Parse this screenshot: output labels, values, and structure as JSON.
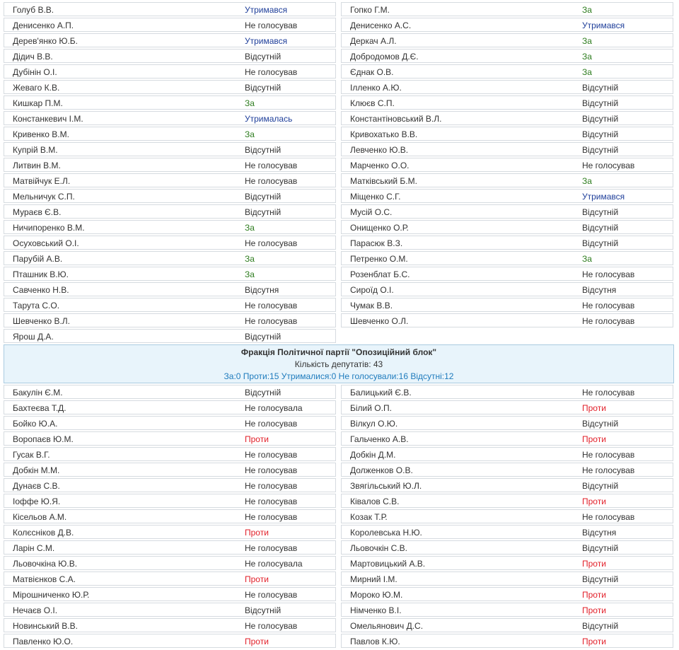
{
  "section1": {
    "rows": [
      {
        "left": {
          "name": "Голуб В.В.",
          "vote": "Утримався",
          "type": "abs"
        },
        "right": {
          "name": "Гопко Г.М.",
          "vote": "За",
          "type": "za"
        }
      },
      {
        "left": {
          "name": "Денисенко А.П.",
          "vote": "Не голосував",
          "type": "none"
        },
        "right": {
          "name": "Денисенко А.С.",
          "vote": "Утримався",
          "type": "abs"
        }
      },
      {
        "left": {
          "name": "Дерев'янко Ю.Б.",
          "vote": "Утримався",
          "type": "abs"
        },
        "right": {
          "name": "Деркач А.Л.",
          "vote": "За",
          "type": "za"
        }
      },
      {
        "left": {
          "name": "Дідич В.В.",
          "vote": "Відсутній",
          "type": "away"
        },
        "right": {
          "name": "Добродомов Д.Є.",
          "vote": "За",
          "type": "za"
        }
      },
      {
        "left": {
          "name": "Дубінін О.І.",
          "vote": "Не голосував",
          "type": "none"
        },
        "right": {
          "name": "Єднак О.В.",
          "vote": "За",
          "type": "za"
        }
      },
      {
        "left": {
          "name": "Жеваго К.В.",
          "vote": "Відсутній",
          "type": "away"
        },
        "right": {
          "name": "Ілленко А.Ю.",
          "vote": "Відсутній",
          "type": "away"
        }
      },
      {
        "left": {
          "name": "Кишкар П.М.",
          "vote": "За",
          "type": "za"
        },
        "right": {
          "name": "Клюєв С.П.",
          "vote": "Відсутній",
          "type": "away"
        }
      },
      {
        "left": {
          "name": "Констанкевич І.М.",
          "vote": "Утрималась",
          "type": "abs"
        },
        "right": {
          "name": "Константіновський В.Л.",
          "vote": "Відсутній",
          "type": "away"
        }
      },
      {
        "left": {
          "name": "Кривенко В.М.",
          "vote": "За",
          "type": "za"
        },
        "right": {
          "name": "Кривохатько В.В.",
          "vote": "Відсутній",
          "type": "away"
        }
      },
      {
        "left": {
          "name": "Купрій В.М.",
          "vote": "Відсутній",
          "type": "away"
        },
        "right": {
          "name": "Левченко Ю.В.",
          "vote": "Відсутній",
          "type": "away"
        }
      },
      {
        "left": {
          "name": "Литвин В.М.",
          "vote": "Не голосував",
          "type": "none"
        },
        "right": {
          "name": "Марченко О.О.",
          "vote": "Не голосував",
          "type": "none"
        }
      },
      {
        "left": {
          "name": "Матвійчук Е.Л.",
          "vote": "Не голосував",
          "type": "none"
        },
        "right": {
          "name": "Матківський Б.М.",
          "vote": "За",
          "type": "za"
        }
      },
      {
        "left": {
          "name": "Мельничук С.П.",
          "vote": "Відсутній",
          "type": "away"
        },
        "right": {
          "name": "Міщенко С.Г.",
          "vote": "Утримався",
          "type": "abs"
        }
      },
      {
        "left": {
          "name": "Мураєв Є.В.",
          "vote": "Відсутній",
          "type": "away"
        },
        "right": {
          "name": "Мусій О.С.",
          "vote": "Відсутній",
          "type": "away"
        }
      },
      {
        "left": {
          "name": "Ничипоренко В.М.",
          "vote": "За",
          "type": "za"
        },
        "right": {
          "name": "Онищенко О.Р.",
          "vote": "Відсутній",
          "type": "away"
        }
      },
      {
        "left": {
          "name": "Осуховський О.І.",
          "vote": "Не голосував",
          "type": "none"
        },
        "right": {
          "name": "Парасюк В.З.",
          "vote": "Відсутній",
          "type": "away"
        }
      },
      {
        "left": {
          "name": "Парубій А.В.",
          "vote": "За",
          "type": "za"
        },
        "right": {
          "name": "Петренко О.М.",
          "vote": "За",
          "type": "za"
        }
      },
      {
        "left": {
          "name": "Пташник В.Ю.",
          "vote": "За",
          "type": "za"
        },
        "right": {
          "name": "Розенблат Б.С.",
          "vote": "Не голосував",
          "type": "none"
        }
      },
      {
        "left": {
          "name": "Савченко Н.В.",
          "vote": "Відсутня",
          "type": "away"
        },
        "right": {
          "name": "Сироїд О.І.",
          "vote": "Відсутня",
          "type": "away"
        }
      },
      {
        "left": {
          "name": "Тарута С.О.",
          "vote": "Не голосував",
          "type": "none"
        },
        "right": {
          "name": "Чумак В.В.",
          "vote": "Не голосував",
          "type": "none"
        }
      },
      {
        "left": {
          "name": "Шевченко В.Л.",
          "vote": "Не голосував",
          "type": "none"
        },
        "right": {
          "name": "Шевченко О.Л.",
          "vote": "Не голосував",
          "type": "none"
        }
      },
      {
        "left": {
          "name": "Ярош Д.А.",
          "vote": "Відсутній",
          "type": "away"
        },
        "right": null
      }
    ]
  },
  "faction": {
    "title": "Фракція Політичної партії \"Опозиційний блок\"",
    "count": "Кількість депутатів: 43",
    "stats": "За:0 Проти:15 Утрималися:0 Не голосували:16 Відсутні:12"
  },
  "section2": {
    "rows": [
      {
        "left": {
          "name": "Бакулін Є.М.",
          "vote": "Відсутній",
          "type": "away"
        },
        "right": {
          "name": "Балицький Є.В.",
          "vote": "Не голосував",
          "type": "none"
        }
      },
      {
        "left": {
          "name": "Бахтеєва Т.Д.",
          "vote": "Не голосувала",
          "type": "none"
        },
        "right": {
          "name": "Білий О.П.",
          "vote": "Проти",
          "type": "proty"
        }
      },
      {
        "left": {
          "name": "Бойко Ю.А.",
          "vote": "Не голосував",
          "type": "none"
        },
        "right": {
          "name": "Вілкул О.Ю.",
          "vote": "Відсутній",
          "type": "away"
        }
      },
      {
        "left": {
          "name": "Воропаєв Ю.М.",
          "vote": "Проти",
          "type": "proty"
        },
        "right": {
          "name": "Гальченко А.В.",
          "vote": "Проти",
          "type": "proty"
        }
      },
      {
        "left": {
          "name": "Гусак В.Г.",
          "vote": "Не голосував",
          "type": "none"
        },
        "right": {
          "name": "Добкін Д.М.",
          "vote": "Не голосував",
          "type": "none"
        }
      },
      {
        "left": {
          "name": "Добкін М.М.",
          "vote": "Не голосував",
          "type": "none"
        },
        "right": {
          "name": "Долженков О.В.",
          "vote": "Не голосував",
          "type": "none"
        }
      },
      {
        "left": {
          "name": "Дунаєв С.В.",
          "vote": "Не голосував",
          "type": "none"
        },
        "right": {
          "name": "Звягільський Ю.Л.",
          "vote": "Відсутній",
          "type": "away"
        }
      },
      {
        "left": {
          "name": "Іоффе Ю.Я.",
          "vote": "Не голосував",
          "type": "none"
        },
        "right": {
          "name": "Ківалов С.В.",
          "vote": "Проти",
          "type": "proty"
        }
      },
      {
        "left": {
          "name": "Кісельов А.М.",
          "vote": "Не голосував",
          "type": "none"
        },
        "right": {
          "name": "Козак Т.Р.",
          "vote": "Не голосував",
          "type": "none"
        }
      },
      {
        "left": {
          "name": "Колєсніков Д.В.",
          "vote": "Проти",
          "type": "proty"
        },
        "right": {
          "name": "Королевська Н.Ю.",
          "vote": "Відсутня",
          "type": "away"
        }
      },
      {
        "left": {
          "name": "Ларін С.М.",
          "vote": "Не голосував",
          "type": "none"
        },
        "right": {
          "name": "Льовочкін С.В.",
          "vote": "Відсутній",
          "type": "away"
        }
      },
      {
        "left": {
          "name": "Льовочкіна Ю.В.",
          "vote": "Не голосувала",
          "type": "none"
        },
        "right": {
          "name": "Мартовицький А.В.",
          "vote": "Проти",
          "type": "proty"
        }
      },
      {
        "left": {
          "name": "Матвієнков С.А.",
          "vote": "Проти",
          "type": "proty"
        },
        "right": {
          "name": "Мирний І.М.",
          "vote": "Відсутній",
          "type": "away"
        }
      },
      {
        "left": {
          "name": "Мірошниченко Ю.Р.",
          "vote": "Не голосував",
          "type": "none"
        },
        "right": {
          "name": "Мороко Ю.М.",
          "vote": "Проти",
          "type": "proty"
        }
      },
      {
        "left": {
          "name": "Нечаєв О.І.",
          "vote": "Відсутній",
          "type": "away"
        },
        "right": {
          "name": "Німченко В.І.",
          "vote": "Проти",
          "type": "proty"
        }
      },
      {
        "left": {
          "name": "Новинський В.В.",
          "vote": "Не голосував",
          "type": "none"
        },
        "right": {
          "name": "Омельянович Д.С.",
          "vote": "Відсутній",
          "type": "away"
        }
      },
      {
        "left": {
          "name": "Павленко Ю.О.",
          "vote": "Проти",
          "type": "proty"
        },
        "right": {
          "name": "Павлов К.Ю.",
          "vote": "Проти",
          "type": "proty"
        }
      }
    ]
  }
}
